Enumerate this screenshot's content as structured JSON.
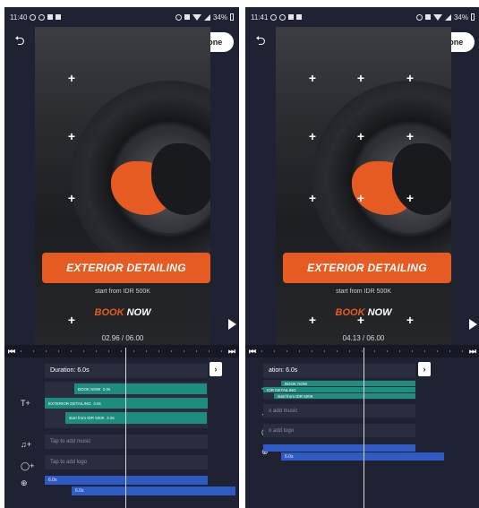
{
  "left": {
    "status": {
      "time": "11:40",
      "battery": "34%"
    },
    "done_label": "Done",
    "banner": "EXTERIOR DETAILING",
    "subtext": "start from IDR 500K",
    "book": {
      "w1": "BOOK",
      "w2": "NOW"
    },
    "time": "02.96 / 06.00",
    "duration": "Duration: 6.0s",
    "clips": [
      "BOOK NOW",
      "EXTERIOR DETAILING",
      "start from IDR 500K"
    ],
    "clip_durations": [
      "2.0s",
      "3.0s",
      "2.0s"
    ],
    "tap_music": "Tap to add music",
    "tap_logo": "Tap to add logo",
    "bars": [
      "6.0s",
      "6.0s"
    ]
  },
  "right": {
    "status": {
      "time": "11:41",
      "battery": "34%"
    },
    "done_label": "Done",
    "banner": "EXTERIOR DETAILING",
    "subtext": "start from IDR 500K",
    "book": {
      "w1": "BOOK",
      "w2": "NOW"
    },
    "time": "04.13 / 06.00",
    "duration": "ation: 6.0s",
    "clips": [
      "BOOK NOW",
      "IOR DETAILING",
      "start from IDR 500K"
    ],
    "tap_music": "o add music",
    "tap_logo": "o add logo",
    "bars": [
      "6.0s"
    ]
  },
  "colors": {
    "accent": "#e65b22",
    "clip": "#1f8c80",
    "bar": "#2f5bc4"
  },
  "icons": [
    "back-arrow-icon",
    "play-icon",
    "skip-start-icon",
    "skip-end-icon",
    "chevron-right-icon",
    "text-track-icon",
    "music-track-icon",
    "logo-track-icon",
    "media-track-icon"
  ]
}
